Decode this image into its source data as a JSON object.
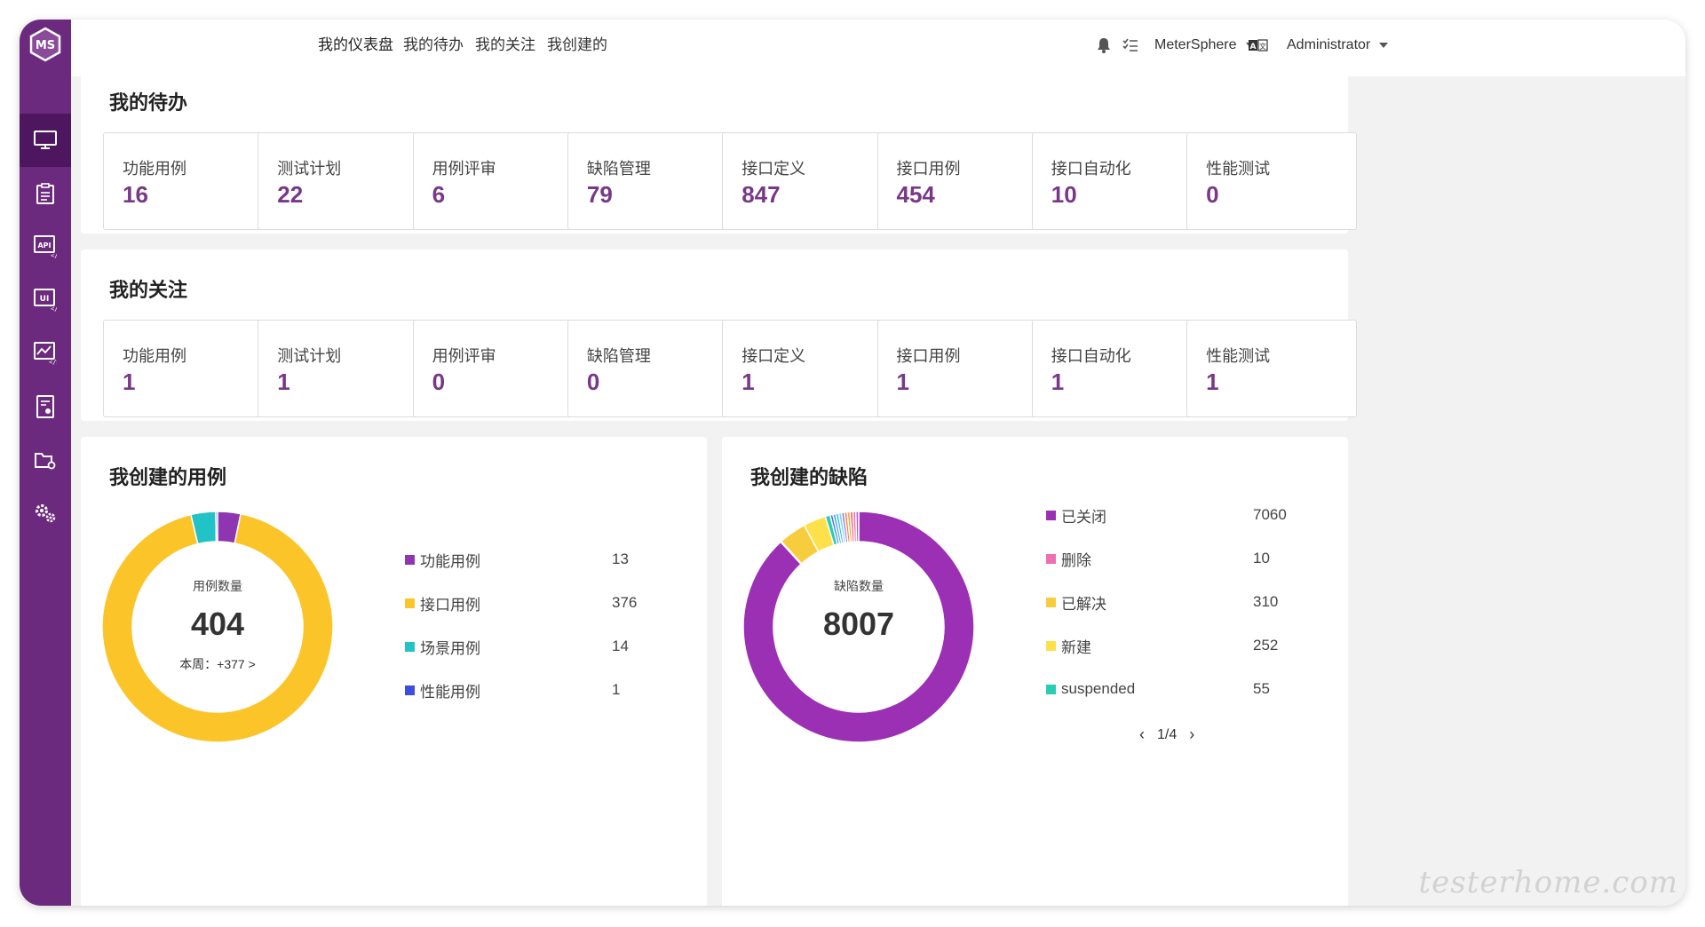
{
  "tabs": [
    {
      "label": "我的仪表盘",
      "active": true
    },
    {
      "label": "我的待办",
      "active": false
    },
    {
      "label": "我的关注",
      "active": false
    },
    {
      "label": "我创建的",
      "active": false
    }
  ],
  "header": {
    "workspace": "MeterSphere",
    "user": "Administrator",
    "icons": [
      "bell-icon",
      "task-list-icon",
      "language-icon"
    ]
  },
  "sidebar": {
    "logo": "MS",
    "items": [
      {
        "icon": "monitor-icon",
        "active": true
      },
      {
        "icon": "clipboard-icon",
        "active": false
      },
      {
        "icon": "api-icon",
        "active": false
      },
      {
        "icon": "ui-icon",
        "active": false
      },
      {
        "icon": "performance-chart-icon",
        "active": false
      },
      {
        "icon": "report-icon",
        "active": false
      },
      {
        "icon": "project-folder-icon",
        "active": false
      },
      {
        "icon": "settings-gears-icon",
        "active": false
      }
    ]
  },
  "todo": {
    "title": "我的待办",
    "items": [
      {
        "label": "功能用例",
        "value": "16"
      },
      {
        "label": "测试计划",
        "value": "22"
      },
      {
        "label": "用例评审",
        "value": "6"
      },
      {
        "label": "缺陷管理",
        "value": "79"
      },
      {
        "label": "接口定义",
        "value": "847"
      },
      {
        "label": "接口用例",
        "value": "454"
      },
      {
        "label": "接口自动化",
        "value": "10"
      },
      {
        "label": "性能测试",
        "value": "0"
      }
    ]
  },
  "follow": {
    "title": "我的关注",
    "items": [
      {
        "label": "功能用例",
        "value": "1"
      },
      {
        "label": "测试计划",
        "value": "1"
      },
      {
        "label": "用例评审",
        "value": "0"
      },
      {
        "label": "缺陷管理",
        "value": "0"
      },
      {
        "label": "接口定义",
        "value": "1"
      },
      {
        "label": "接口用例",
        "value": "1"
      },
      {
        "label": "接口自动化",
        "value": "1"
      },
      {
        "label": "性能测试",
        "value": "1"
      }
    ]
  },
  "cases": {
    "title": "我创建的用例",
    "center_label": "用例数量",
    "total": "404",
    "week": "本周：+377 >"
  },
  "bugs": {
    "title": "我创建的缺陷",
    "center_label": "缺陷数量",
    "total": "8007",
    "pager": "1/4"
  },
  "chart_data": [
    {
      "type": "pie",
      "title": "我创建的用例",
      "donut": true,
      "categories": [
        "功能用例",
        "接口用例",
        "场景用例",
        "性能用例"
      ],
      "values": [
        13,
        376,
        14,
        1
      ],
      "colors": [
        "#8e36b1",
        "#fbc52a",
        "#22c3c6",
        "#3c4de0"
      ]
    },
    {
      "type": "pie",
      "title": "我创建的缺陷",
      "donut": true,
      "categories": [
        "已关闭",
        "删除",
        "已解决",
        "新建",
        "suspended"
      ],
      "values": [
        7060,
        10,
        310,
        252,
        55
      ],
      "colors": [
        "#9c30b4",
        "#ee6fb2",
        "#f8cd3d",
        "#fde04a",
        "#29cdb1"
      ],
      "legend_page": "1/4"
    }
  ],
  "watermark": "testerhome.com"
}
